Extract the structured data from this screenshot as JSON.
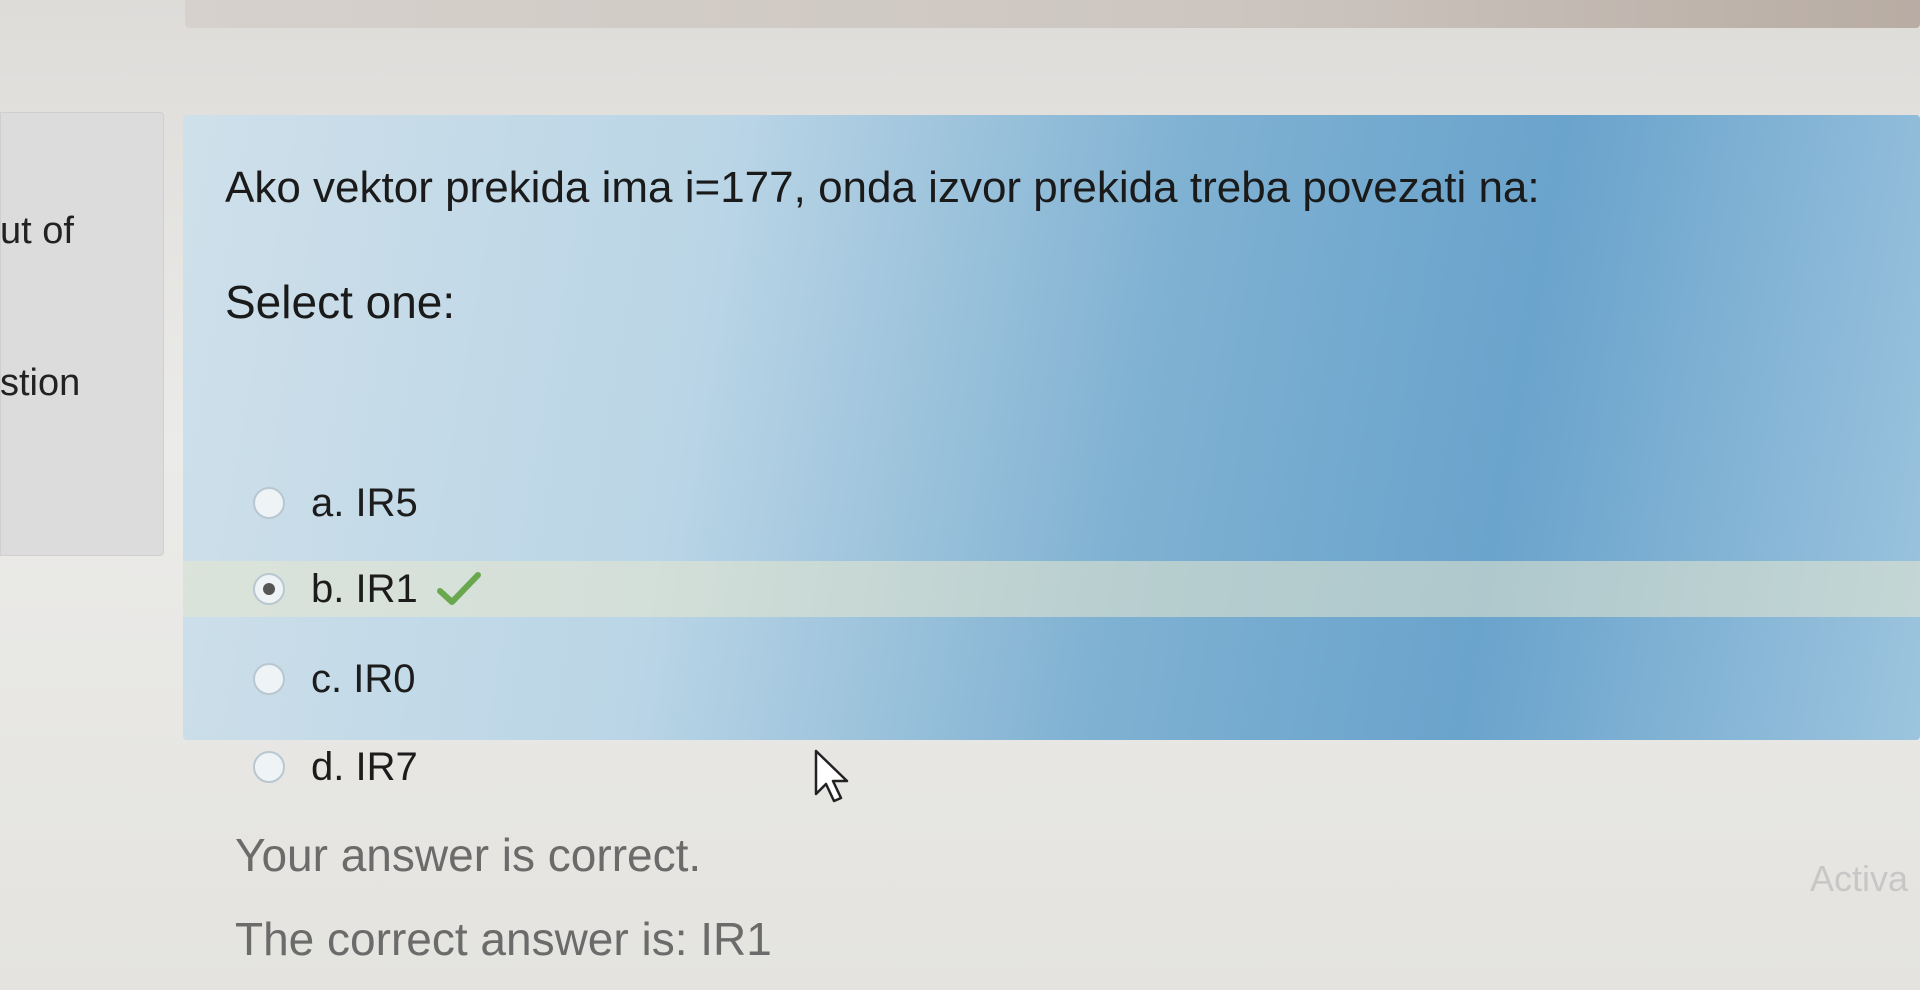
{
  "sidebar": {
    "out_of_fragment": "ut of",
    "question_fragment": "stion"
  },
  "question": {
    "text": "Ako vektor prekida ima i=177, onda izvor prekida treba povezati na:",
    "prompt": "Select one:",
    "options": [
      {
        "label": "a. IR5",
        "selected": false
      },
      {
        "label": "b. IR1",
        "selected": true,
        "correct": true
      },
      {
        "label": "c. IR0",
        "selected": false
      },
      {
        "label": "d. IR7",
        "selected": false
      }
    ]
  },
  "feedback": {
    "result": "Your answer is correct.",
    "correct_answer": "The correct answer is: IR1"
  },
  "watermark": {
    "text": "Activa"
  },
  "icons": {
    "check": "check-icon",
    "cursor": "mouse-pointer-icon"
  },
  "colors": {
    "question_bg": "#bad5e6",
    "correct_check": "#6aa84f"
  }
}
